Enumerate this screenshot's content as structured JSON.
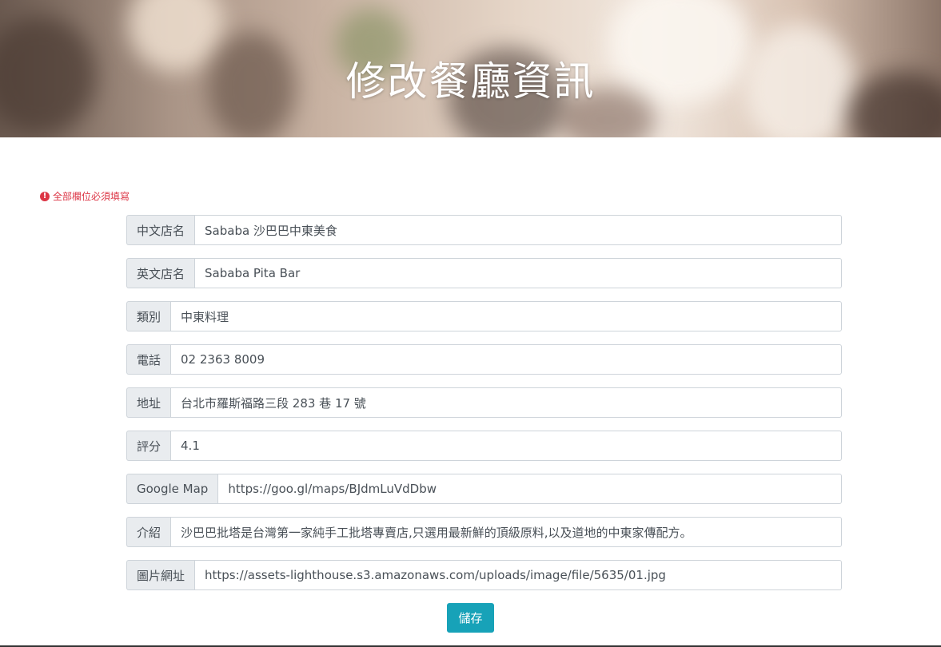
{
  "header": {
    "title": "修改餐廳資訊"
  },
  "form": {
    "required_note": "全部欄位必須填寫",
    "fields": [
      {
        "label": "中文店名",
        "value": "Sababa 沙巴巴中東美食"
      },
      {
        "label": "英文店名",
        "value": "Sababa Pita Bar"
      },
      {
        "label": "類別",
        "value": "中東料理"
      },
      {
        "label": "電話",
        "value": "02 2363 8009"
      },
      {
        "label": "地址",
        "value": "台北市羅斯福路三段 283 巷 17 號"
      },
      {
        "label": "評分",
        "value": "4.1"
      },
      {
        "label": "Google Map",
        "value": "https://goo.gl/maps/BJdmLuVdDbw"
      },
      {
        "label": "介紹",
        "value": "沙巴巴批塔是台灣第一家純手工批塔專賣店,只選用最新鮮的頂級原料,以及道地的中東家傳配方。"
      },
      {
        "label": "圖片網址",
        "value": "https://assets-lighthouse.s3.amazonaws.com/uploads/image/file/5635/01.jpg"
      }
    ],
    "save_label": "儲存"
  },
  "colors": {
    "accent": "#17a2b8",
    "error": "#dc3545",
    "label_bg": "#e9ecef",
    "border": "#ced4da"
  },
  "icons": {
    "required_note_icon": "exclamation-circle-icon"
  }
}
